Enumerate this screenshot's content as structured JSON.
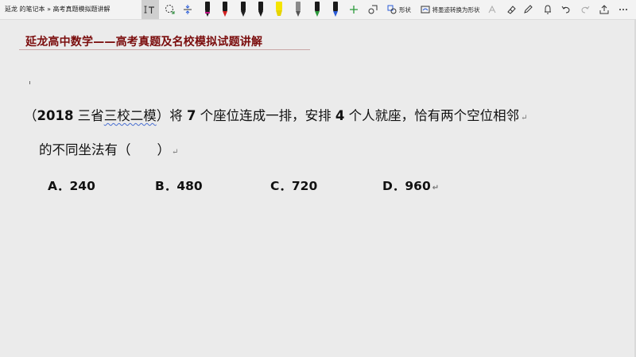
{
  "window": {
    "title": "延龙 的笔记本 » 高考真题模拟题讲解"
  },
  "toolbar": {
    "shape_label": "形状",
    "ink_to_shape_label": "将墨迹转换为形状"
  },
  "colors": {
    "pen_black": "#1a1a1a",
    "pen_red": "#d32020",
    "pen_dark": "#222222",
    "pen_yellow": "#f5e400",
    "pen_gray": "#8a8a8a",
    "pen_green": "#2b9a3a",
    "pen_blue": "#2a5bd7",
    "header_title": "#7a0c0c"
  },
  "page": {
    "header_title": "延龙高中数学——高考真题及名校模拟试题讲解",
    "question": {
      "open_paren": "（",
      "source_year": "2018",
      "source_text_a": " 三省",
      "source_text_b": "三校二模",
      "close_paren": "）",
      "text_1": "将 ",
      "num_seats": "7",
      "text_2": " 个座位连成一排，安排 ",
      "num_people": "4",
      "text_3": " 个人就座，恰有两个空位相邻",
      "line2": "的不同坐法有（　　）"
    },
    "options": [
      {
        "letter": "A．",
        "value": "240"
      },
      {
        "letter": "B．",
        "value": "480"
      },
      {
        "letter": "C．",
        "value": "720"
      },
      {
        "letter": "D．",
        "value": "960"
      }
    ]
  }
}
